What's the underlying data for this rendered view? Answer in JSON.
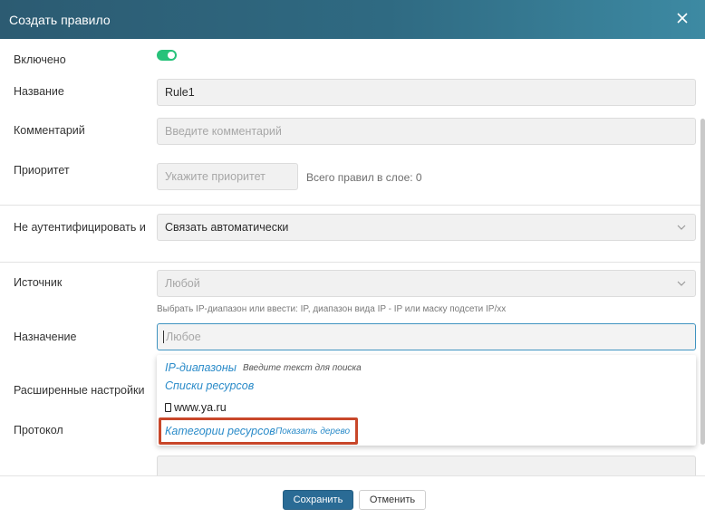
{
  "dialog": {
    "title": "Создать правило",
    "close_icon": "close-icon"
  },
  "form": {
    "enabled_label": "Включено",
    "enabled": true,
    "name_label": "Название",
    "name_value": "Rule1",
    "comment_label": "Комментарий",
    "comment_placeholder": "Введите комментарий",
    "priority_label": "Приоритет",
    "priority_placeholder": "Укажите приоритет",
    "priority_note": "Всего правил в слое: 0",
    "noauth_label": "Не аутентифицировать и",
    "noauth_value": "Связать автоматически",
    "source_label": "Источник",
    "source_value": "Любой",
    "source_hint": "Выбрать IP-диапазон или ввести: IP, диапазон вида IP - IP или маску подсети IP/xx",
    "destination_label": "Назначение",
    "destination_placeholder": "Любое",
    "advanced_label": "Расширенные настройки",
    "protocol_label": "Протокол"
  },
  "dropdown": {
    "ip_ranges": "IP-диапазоны",
    "ip_ranges_note": "Введите текст для поиска",
    "resource_lists": "Списки ресурсов",
    "item": "www.ya.ru",
    "resource_categories": "Категории ресурсов",
    "show_tree": "Показать дерево"
  },
  "footer": {
    "save_label": "Сохранить",
    "cancel_label": "Отменить"
  },
  "colors": {
    "header": "#2f6a82",
    "accent": "#2a8bc9",
    "toggle_on": "#27c27a",
    "highlight": "#c8472a",
    "save_button": "#2a6b95"
  }
}
